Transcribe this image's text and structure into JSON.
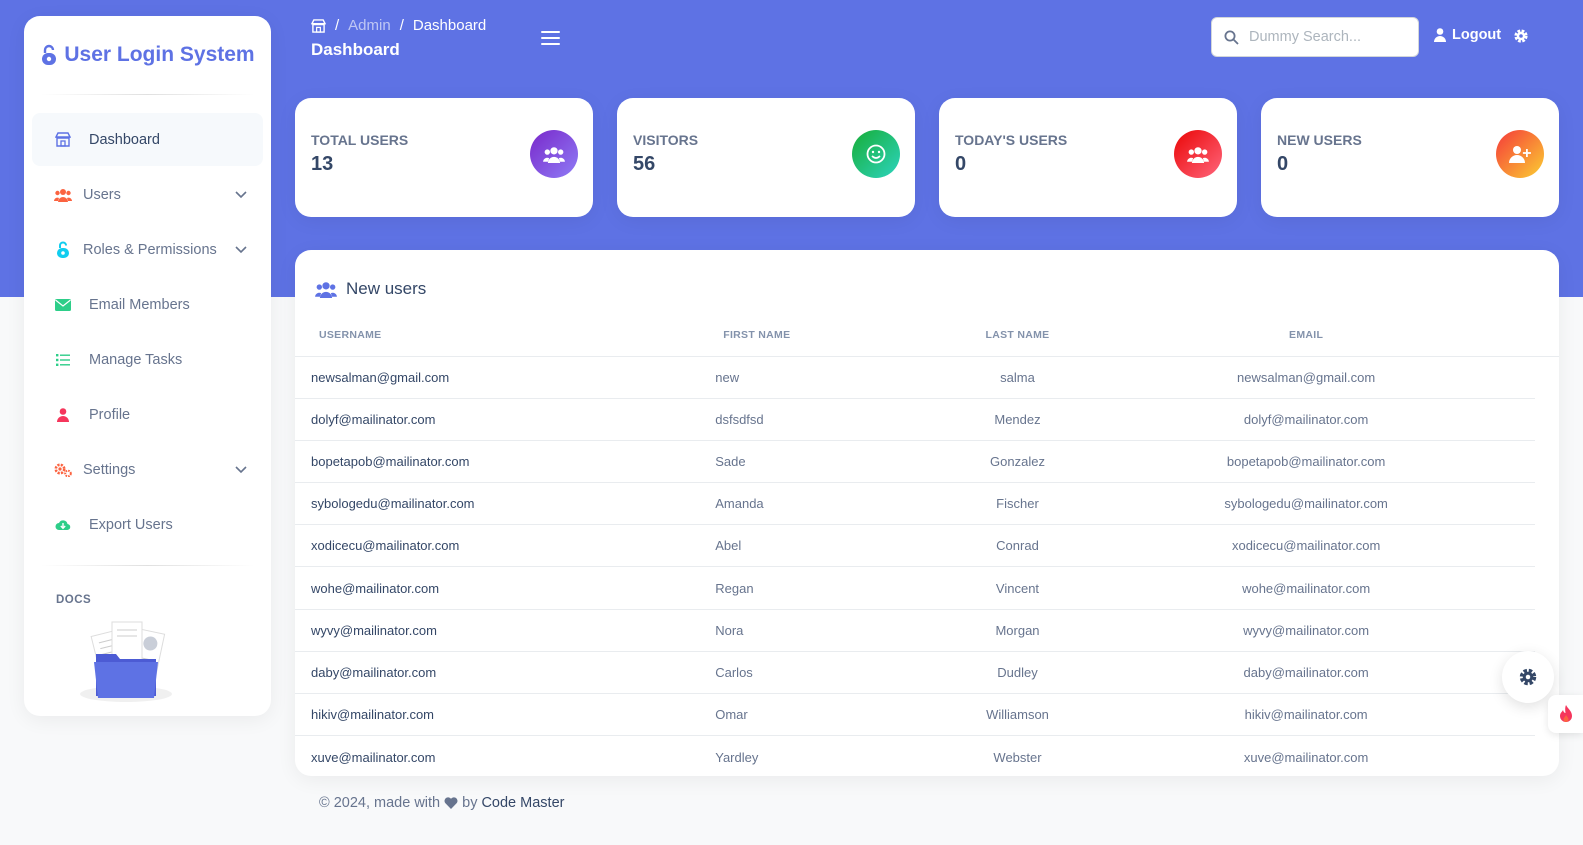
{
  "brand": {
    "title": "User Login System"
  },
  "sidebar": {
    "items": [
      {
        "label": "Dashboard",
        "icon": "shop-icon"
      },
      {
        "label": "Users",
        "icon": "users-icon"
      },
      {
        "label": "Roles & Permissions",
        "icon": "unlock-icon"
      },
      {
        "label": "Email Members",
        "icon": "envelope-icon"
      },
      {
        "label": "Manage Tasks",
        "icon": "list-icon"
      },
      {
        "label": "Profile",
        "icon": "user-icon"
      },
      {
        "label": "Settings",
        "icon": "gears-icon"
      },
      {
        "label": "Export Users",
        "icon": "cloud-download-icon"
      }
    ],
    "docs_label": "DOCS"
  },
  "header": {
    "breadcrumb": {
      "admin": "Admin",
      "current": "Dashboard"
    },
    "title": "Dashboard",
    "search_placeholder": "Dummy Search...",
    "logout_label": "Logout"
  },
  "stats": [
    {
      "label": "TOTAL USERS",
      "value": "13",
      "color": "#7b5cf0"
    },
    {
      "label": "VISITORS",
      "value": "56",
      "color": "#2dce89"
    },
    {
      "label": "TODAY'S USERS",
      "value": "0",
      "color": "#f5365c"
    },
    {
      "label": "NEW USERS",
      "value": "0",
      "color": "#fb6340"
    }
  ],
  "table": {
    "title": "New users",
    "columns": [
      "USERNAME",
      "FIRST NAME",
      "LAST NAME",
      "EMAIL"
    ],
    "rows": [
      [
        "newsalman@gmail.com",
        "new",
        "salma",
        "newsalman@gmail.com"
      ],
      [
        "dolyf@mailinator.com",
        "dsfsdfsd",
        "Mendez",
        "dolyf@mailinator.com"
      ],
      [
        "bopetapob@mailinator.com",
        "Sade",
        "Gonzalez",
        "bopetapob@mailinator.com"
      ],
      [
        "sybologedu@mailinator.com",
        "Amanda",
        "Fischer",
        "sybologedu@mailinator.com"
      ],
      [
        "xodicecu@mailinator.com",
        "Abel",
        "Conrad",
        "xodicecu@mailinator.com"
      ],
      [
        "wohe@mailinator.com",
        "Regan",
        "Vincent",
        "wohe@mailinator.com"
      ],
      [
        "wyvy@mailinator.com",
        "Nora",
        "Morgan",
        "wyvy@mailinator.com"
      ],
      [
        "daby@mailinator.com",
        "Carlos",
        "Dudley",
        "daby@mailinator.com"
      ],
      [
        "hikiv@mailinator.com",
        "Omar",
        "Williamson",
        "hikiv@mailinator.com"
      ],
      [
        "xuve@mailinator.com",
        "Yardley",
        "Webster",
        "xuve@mailinator.com"
      ]
    ]
  },
  "footer": {
    "text": "© 2024, made with",
    "by": "by",
    "author": "Code Master"
  },
  "colors": {
    "primary": "#5e72e4",
    "text_dark": "#344767",
    "text_muted": "#67748e"
  }
}
